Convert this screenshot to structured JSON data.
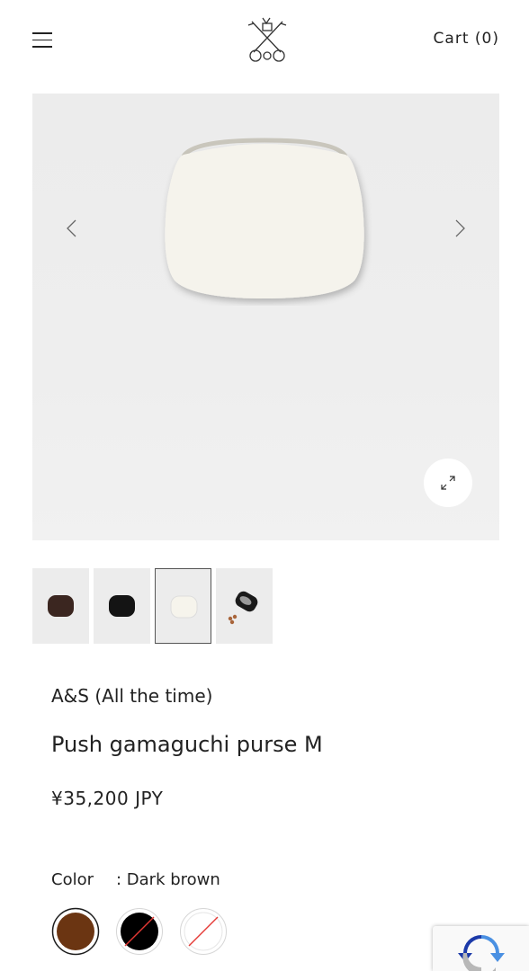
{
  "header": {
    "menu_icon": "hamburger-menu-icon",
    "logo_icon": "crossed-keys-crest-icon",
    "cart_label": "Cart",
    "cart_count": "(0)"
  },
  "gallery": {
    "prev_icon": "chevron-left-icon",
    "next_icon": "chevron-right-icon",
    "zoom_icon": "expand-diagonal-arrows-icon",
    "current_image": "white push gamaguchi purse",
    "thumbnails": [
      {
        "color": "#3b2620",
        "active": false
      },
      {
        "color": "#141414",
        "active": false
      },
      {
        "color": "#f2f0e8",
        "active": true
      },
      {
        "color": "#1a1a1a",
        "active": false
      }
    ]
  },
  "product": {
    "brand": "A&S (All the time)",
    "title": "Push gamaguchi purse M",
    "price": "¥35,200  JPY",
    "color_label": "Color",
    "color_value": ": Dark brown",
    "swatches": [
      {
        "color": "#6b3512",
        "selected": true,
        "available": true
      },
      {
        "color": "#000000",
        "selected": false,
        "available": false
      },
      {
        "color": "#ffffff",
        "selected": false,
        "available": false
      }
    ]
  },
  "widgets": {
    "recaptcha_icon": "recaptcha-logo-icon"
  }
}
